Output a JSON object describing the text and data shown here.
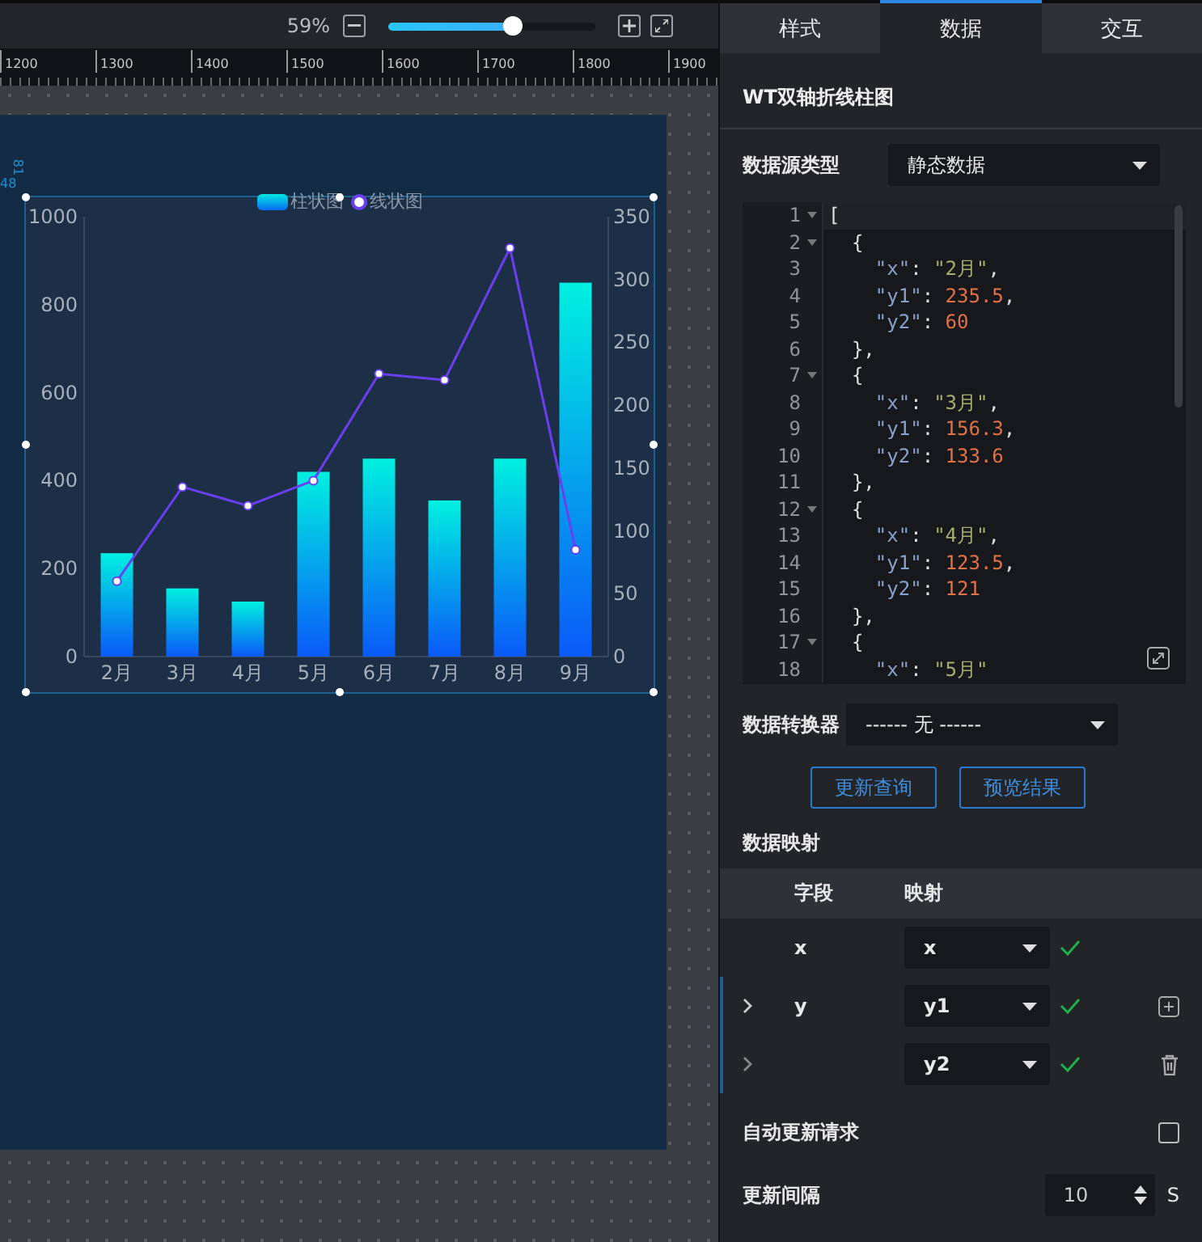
{
  "toolbar": {
    "zoom": "59%",
    "zoom_slider": {
      "level": 0.6
    }
  },
  "ruler": {
    "labels": [
      "1200",
      "1300",
      "1400",
      "1500",
      "1600",
      "1700",
      "1800",
      "1900"
    ]
  },
  "guide_labels": [
    "81",
    "48"
  ],
  "chart": {
    "chart_data": {
      "type": "bar",
      "stacked": false,
      "categories": [
        "2月",
        "3月",
        "4月",
        "5月",
        "6月",
        "7月",
        "8月",
        "9月"
      ],
      "series": [
        {
          "name": "柱状图",
          "color": "#00f0e0",
          "values": [
            235,
            155,
            125,
            420,
            450,
            355,
            450,
            850
          ]
        },
        {
          "name": "线状图",
          "type": "line",
          "axis": "y2",
          "marker": "circle",
          "color": "#6a3ff0",
          "values": [
            60,
            135,
            120,
            140,
            225,
            220,
            325,
            85
          ]
        }
      ],
      "ylim": [
        0,
        1000
      ],
      "yticks": [
        0,
        200,
        400,
        600,
        800,
        1000
      ],
      "y2lim": [
        0,
        350
      ],
      "y2ticks": [
        0,
        50,
        100,
        150,
        200,
        250,
        300,
        350
      ]
    }
  },
  "panel": {
    "tabs": [
      {
        "label": "样式",
        "selected": false
      },
      {
        "label": "数据",
        "selected": true
      },
      {
        "label": "交互",
        "selected": false
      }
    ],
    "title": "WT双轴折线柱图",
    "source_type": {
      "label": "数据源类型",
      "value": "静态数据"
    },
    "editor": {
      "lines": [
        {
          "n": "1",
          "fold": true,
          "text": "["
        },
        {
          "n": "2",
          "fold": true,
          "text": "  {"
        },
        {
          "n": "3",
          "fold": false,
          "text": "    \"x\": \"2月\","
        },
        {
          "n": "4",
          "fold": false,
          "text": "    \"y1\": 235.5,"
        },
        {
          "n": "5",
          "fold": false,
          "text": "    \"y2\": 60"
        },
        {
          "n": "6",
          "fold": false,
          "text": "  },"
        },
        {
          "n": "7",
          "fold": true,
          "text": "  {"
        },
        {
          "n": "8",
          "fold": false,
          "text": "    \"x\": \"3月\","
        },
        {
          "n": "9",
          "fold": false,
          "text": "    \"y1\": 156.3,"
        },
        {
          "n": "10",
          "fold": false,
          "text": "    \"y2\": 133.6"
        },
        {
          "n": "11",
          "fold": false,
          "text": "  },"
        },
        {
          "n": "12",
          "fold": true,
          "text": "  {"
        },
        {
          "n": "13",
          "fold": false,
          "text": "    \"x\": \"4月\","
        },
        {
          "n": "14",
          "fold": false,
          "text": "    \"y1\": 123.5,"
        },
        {
          "n": "15",
          "fold": false,
          "text": "    \"y2\": 121"
        },
        {
          "n": "16",
          "fold": false,
          "text": "  },"
        },
        {
          "n": "17",
          "fold": true,
          "text": "  {"
        },
        {
          "n": "18",
          "fold": false,
          "text": "    \"x\": \"5月\""
        }
      ]
    },
    "converter": {
      "label": "数据转换器",
      "value": "------ 无 ------"
    },
    "buttons": [
      "更新查询",
      "预览结果"
    ],
    "mapping": {
      "title": "数据映射",
      "columns": [
        "字段",
        "映射"
      ],
      "rows": [
        {
          "field": "x",
          "value": "x",
          "expandable": false,
          "grouped": false,
          "valid": true,
          "kind": "plain"
        },
        {
          "field": "y",
          "value": "y1",
          "expandable": true,
          "grouped": true,
          "valid": true,
          "kind": "add"
        },
        {
          "value": "y2",
          "expandable": true,
          "grouped": true,
          "valid": true,
          "kind": "delete"
        }
      ]
    },
    "auto_update": {
      "label": "自动更新请求",
      "checked": false
    },
    "interval": {
      "label": "更新间隔",
      "value": "10",
      "unit": "S"
    }
  }
}
